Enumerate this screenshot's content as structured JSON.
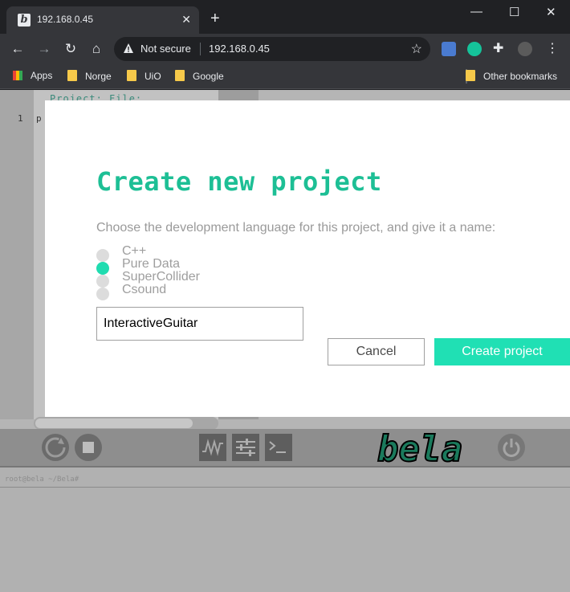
{
  "browser": {
    "tab_title": "192.168.0.45",
    "tab_favicon": "bela-b-icon",
    "security_label": "Not secure",
    "url": "192.168.0.45",
    "bookmarks": [
      {
        "label": "Apps",
        "icon": "apps-grid-icon"
      },
      {
        "label": "Norge",
        "icon": "folder-icon"
      },
      {
        "label": "UiO",
        "icon": "folder-icon"
      },
      {
        "label": "Google",
        "icon": "folder-icon"
      }
    ],
    "other_bookmarks": "Other bookmarks"
  },
  "ide": {
    "header_text": "Project:   File:",
    "line_number": "1",
    "code_fragment": "p",
    "console_prompt": "root@bela ~/Bela#",
    "logo_text": "bela"
  },
  "modal": {
    "title": "Create new project",
    "description": "Choose the development language for this project, and give it a name:",
    "languages": [
      {
        "label": "C++",
        "selected": false
      },
      {
        "label": "Pure Data",
        "selected": true
      },
      {
        "label": "SuperCollider",
        "selected": false
      },
      {
        "label": "Csound",
        "selected": false
      }
    ],
    "project_name": "InteractiveGuitar",
    "cancel_label": "Cancel",
    "create_label": "Create project"
  },
  "colors": {
    "accent": "#1dbf95",
    "button_create": "#20e0b4",
    "selected_radio": "#20dcb0",
    "logo_green": "#1a7a5c"
  }
}
